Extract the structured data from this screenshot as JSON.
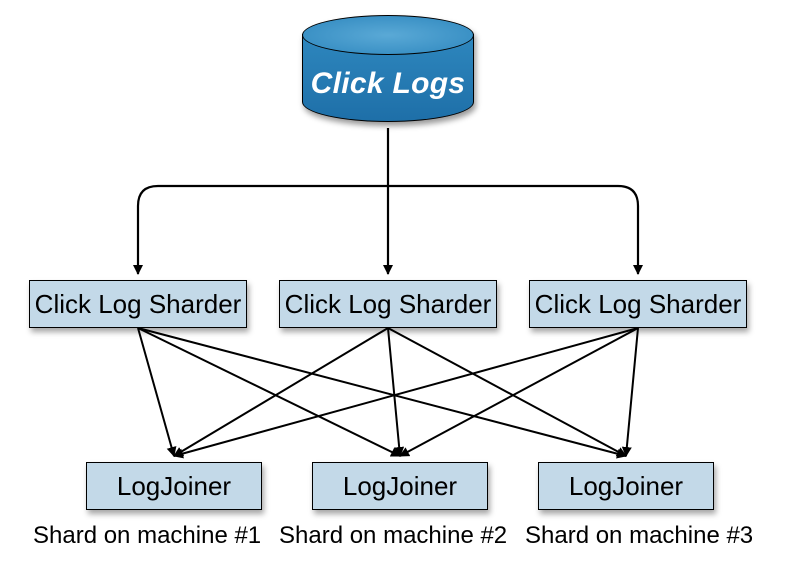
{
  "source": {
    "label": "Click Logs"
  },
  "sharders": [
    {
      "label": "Click Log Sharder"
    },
    {
      "label": "Click Log Sharder"
    },
    {
      "label": "Click Log Sharder"
    }
  ],
  "joiners": [
    {
      "label": "LogJoiner"
    },
    {
      "label": "LogJoiner"
    },
    {
      "label": "LogJoiner"
    }
  ],
  "footers": [
    {
      "label": "Shard on machine #1"
    },
    {
      "label": "Shard on machine #2"
    },
    {
      "label": "Shard on machine #3"
    }
  ],
  "colors": {
    "box_fill": "#c3d9e8",
    "cylinder_fill": "#2e87be",
    "line": "#000000"
  }
}
